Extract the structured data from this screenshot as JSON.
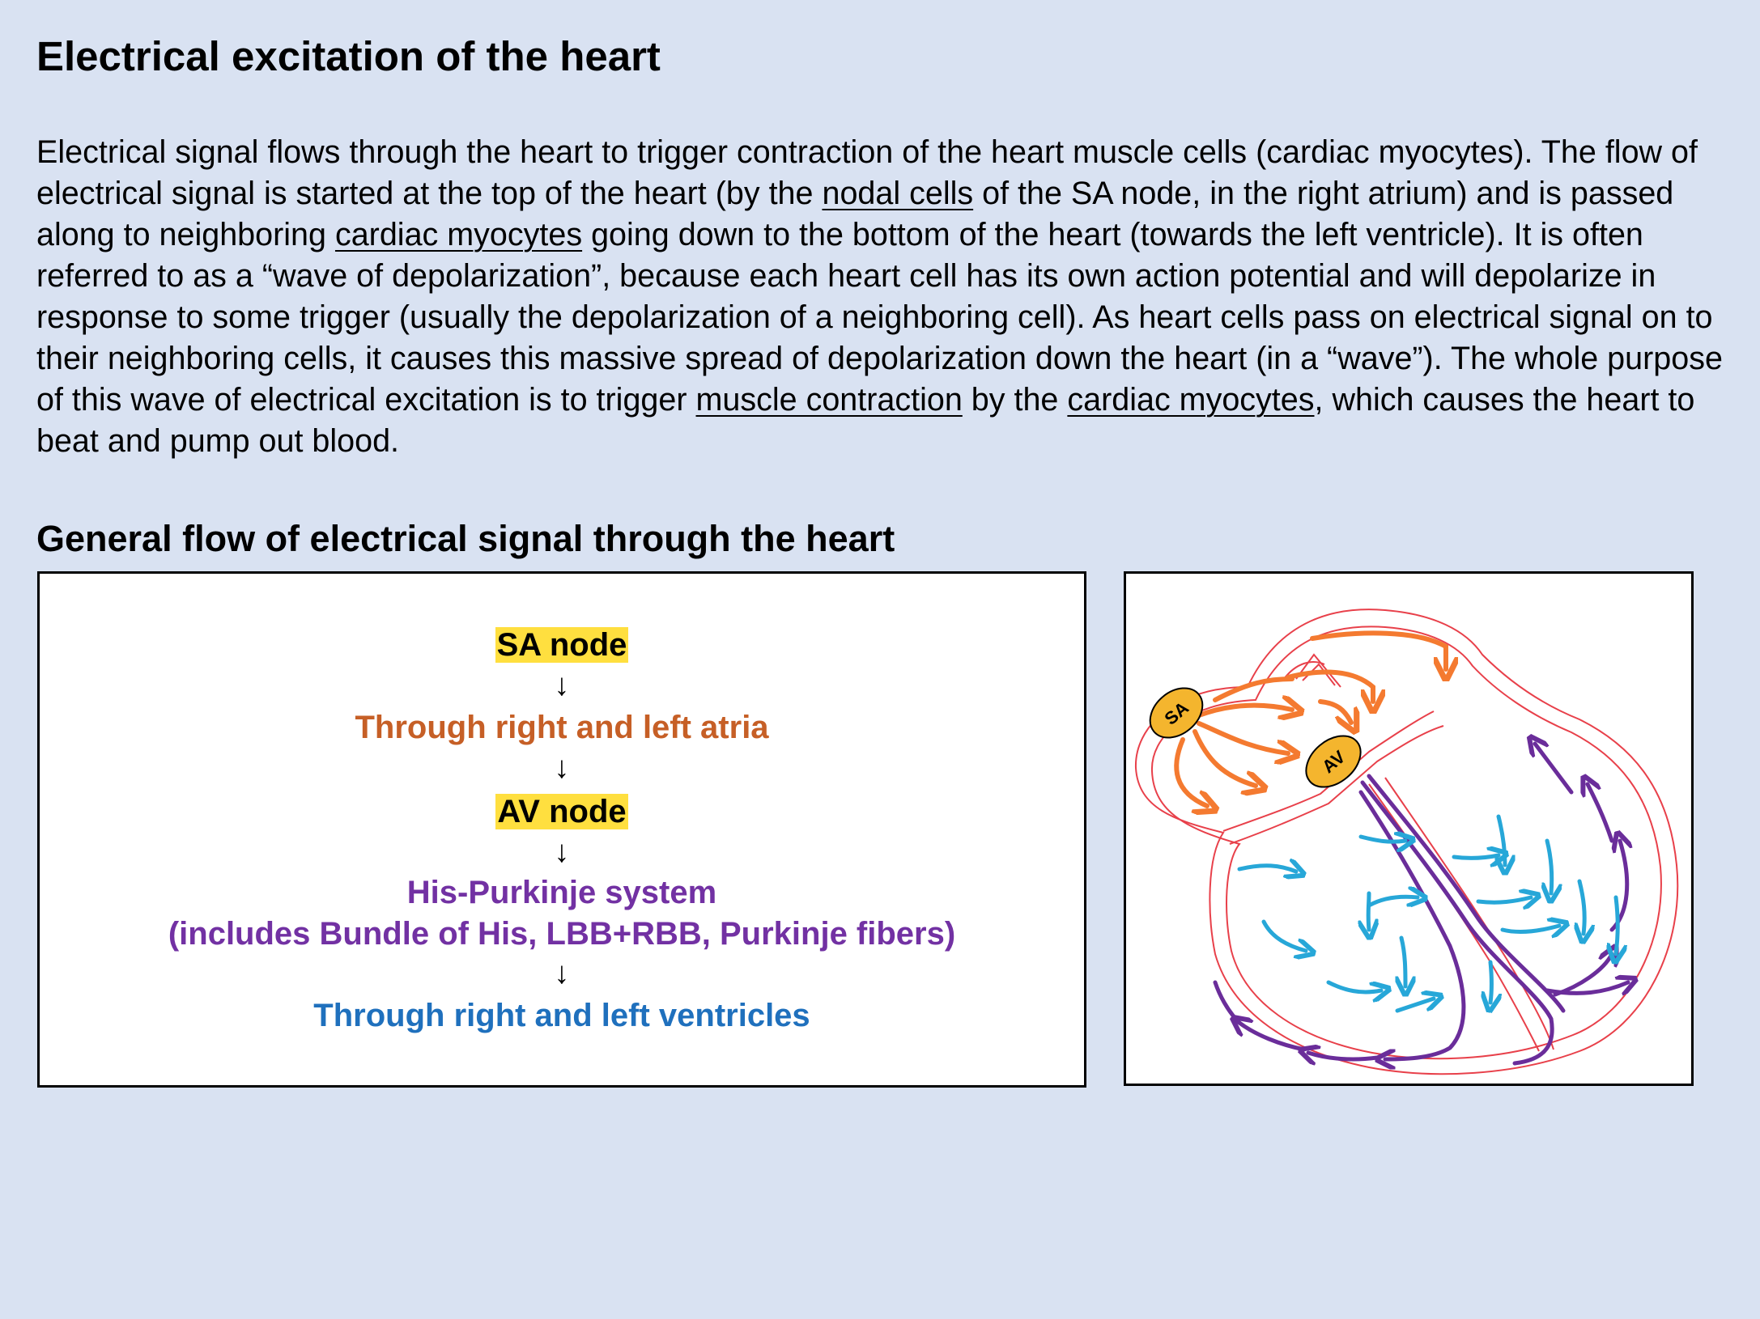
{
  "title": "Electrical excitation of the heart",
  "paragraph": {
    "t1": "Electrical signal flows through the heart to trigger contraction of the heart muscle cells (cardiac myocytes). The flow of electrical signal is started at the top of the heart (by the ",
    "u1": "nodal cells",
    "t2": " of the SA node, in the right atrium) and is passed along to neighboring ",
    "u2": "cardiac myocytes",
    "t3": " going down to the bottom of the heart (towards the left ventricle). It is often referred to as a “wave of depolarization”, because each heart cell has its own action potential and will depolarize in response to some trigger (usually the depolarization of a neighboring cell). As  heart cells pass on electrical signal on to their neighboring cells, it causes this massive spread of depolarization down the heart (in a “wave”). The whole purpose of this wave of electrical excitation is to trigger ",
    "u3": "muscle contraction",
    "t4": " by the ",
    "u4": "cardiac myocytes",
    "t5": ", which causes the heart to beat and pump out blood."
  },
  "subtitle": "General flow of electrical signal through the heart",
  "flow": {
    "sa_node": "SA node",
    "atria": "Through right and left atria",
    "av_node": "AV node",
    "his_purkinje": "His-Purkinje system",
    "his_purkinje_detail": "(includes Bundle of His, LBB+RBB, Purkinje fibers)",
    "ventricles": "Through right and left ventricles",
    "arrow_glyph": "↓"
  },
  "diagram": {
    "sa_label": "SA",
    "av_label": "AV"
  },
  "colors": {
    "background": "#d9e2f2",
    "highlight": "#ffdf3f",
    "atria_text": "#c65f26",
    "purkinje_text": "#7231a3",
    "ventricle_text": "#1f70bd",
    "heart_outline": "#e8404a",
    "atrial_arrows": "#f47a30",
    "purkinje_arrows": "#6a2d9a",
    "ventricle_arrows": "#27a7d8",
    "node_fill": "#f4b52e"
  }
}
